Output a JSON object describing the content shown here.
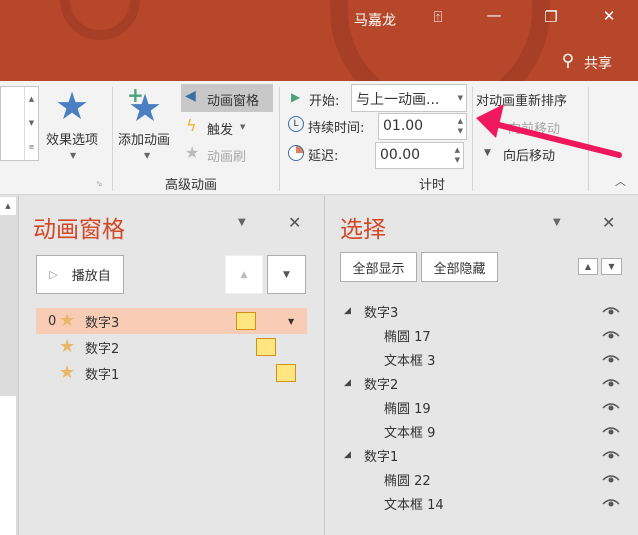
{
  "titlebar": {
    "user": "马嘉龙",
    "share_label": "共享",
    "icons": [
      "ribbon-display-icon",
      "minimize-icon",
      "restore-icon",
      "close-icon",
      "share-person-icon"
    ]
  },
  "ribbon": {
    "effect_options": "效果选项",
    "add_animation": "添加动画",
    "animation_pane": "动画窗格",
    "trigger": "触发",
    "animation_painter": "动画刷",
    "group_advanced": "高级动画",
    "start_label": "开始:",
    "start_value": "与上一动画...",
    "duration_label": "持续时间:",
    "duration_value": "01.00",
    "delay_label": "延迟:",
    "delay_value": "00.00",
    "group_timing": "计时",
    "reorder_label": "对动画重新排序",
    "move_earlier": "向前移动",
    "move_later": "向后移动"
  },
  "animation_pane": {
    "title": "动画窗格",
    "play_from": "播放自",
    "items": [
      {
        "index": "0",
        "label": "数字3",
        "selected": true
      },
      {
        "index": "",
        "label": "数字2",
        "selected": false
      },
      {
        "index": "",
        "label": "数字1",
        "selected": false
      }
    ]
  },
  "selection_pane": {
    "title": "选择",
    "show_all": "全部显示",
    "hide_all": "全部隐藏",
    "tree": [
      {
        "label": "数字3",
        "level": 0
      },
      {
        "label": "椭圆 17",
        "level": 1
      },
      {
        "label": "文本框 3",
        "level": 1
      },
      {
        "label": "数字2",
        "level": 0
      },
      {
        "label": "椭圆 19",
        "level": 1
      },
      {
        "label": "文本框 9",
        "level": 1
      },
      {
        "label": "数字1",
        "level": 0
      },
      {
        "label": "椭圆 22",
        "level": 1
      },
      {
        "label": "文本框 14",
        "level": 1
      }
    ]
  },
  "colors": {
    "accent": "#b7472a",
    "pane_title": "#d24726",
    "selected_row": "#f9cdb5",
    "annotation_arrow": "#f0185c"
  }
}
